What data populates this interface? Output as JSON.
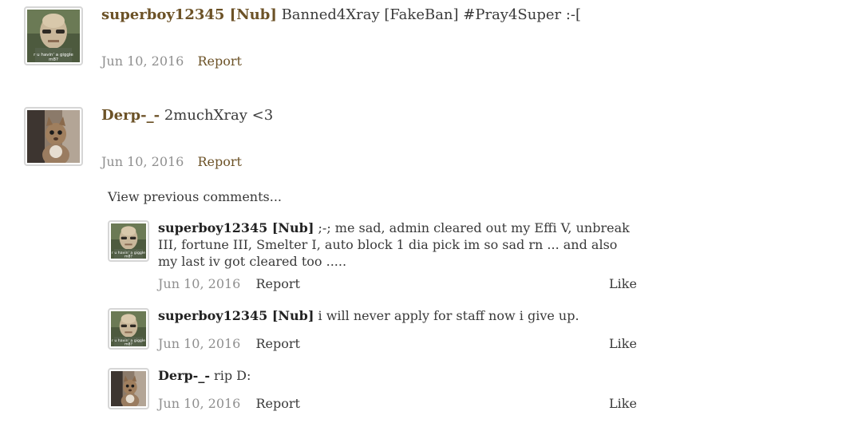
{
  "posts": [
    {
      "author": "superboy12345 [Nub]",
      "message": "Banned4Xray [FakeBan] #Pray4Super :-[",
      "date": "Jun 10, 2016",
      "report": "Report",
      "avatar_caption_1": "r u havin' a giggle",
      "avatar_caption_2": "m8?"
    },
    {
      "author": "Derp-_-",
      "message": "2muchXray <3",
      "date": "Jun 10, 2016",
      "report": "Report"
    }
  ],
  "view_previous": "View previous comments...",
  "comments": [
    {
      "author": "superboy12345 [Nub]",
      "message": ";-; me sad, admin cleared out my Effi V, unbreak III, fortune III, Smelter I, auto block 1 dia pick im so sad rn ... and also my last iv got cleared too .....",
      "date": "Jun 10, 2016",
      "report": "Report",
      "like": "Like"
    },
    {
      "author": "superboy12345 [Nub]",
      "message": "i will never apply for staff now i give up.",
      "date": "Jun 10, 2016",
      "report": "Report",
      "like": "Like"
    },
    {
      "author": "Derp-_-",
      "message": "rip D:",
      "date": "Jun 10, 2016",
      "report": "Report",
      "like": "Like"
    }
  ]
}
